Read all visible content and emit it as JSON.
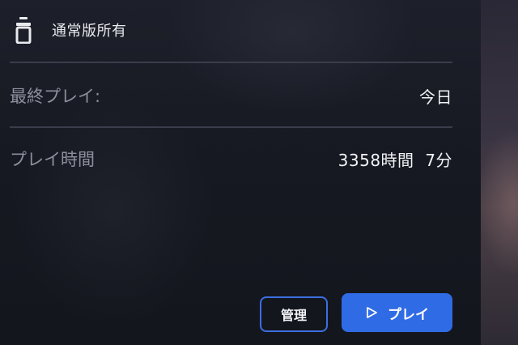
{
  "ownership": {
    "icon": "bottle-icon",
    "label": "通常版所有"
  },
  "rows": [
    {
      "label": "最終プレイ:",
      "value": "今日"
    },
    {
      "label": "プレイ時間",
      "value": "3358時間  7分"
    }
  ],
  "buttons": {
    "manage_label": "管理",
    "play_label": "プレイ",
    "play_icon": "play-triangle-icon"
  },
  "colors": {
    "accent": "#2f6be4",
    "accent_border": "#3b6fe0",
    "background": "#14161e",
    "divider": "#3a3d4a",
    "label_text": "#8d909c",
    "value_text": "#f2f3f6"
  }
}
